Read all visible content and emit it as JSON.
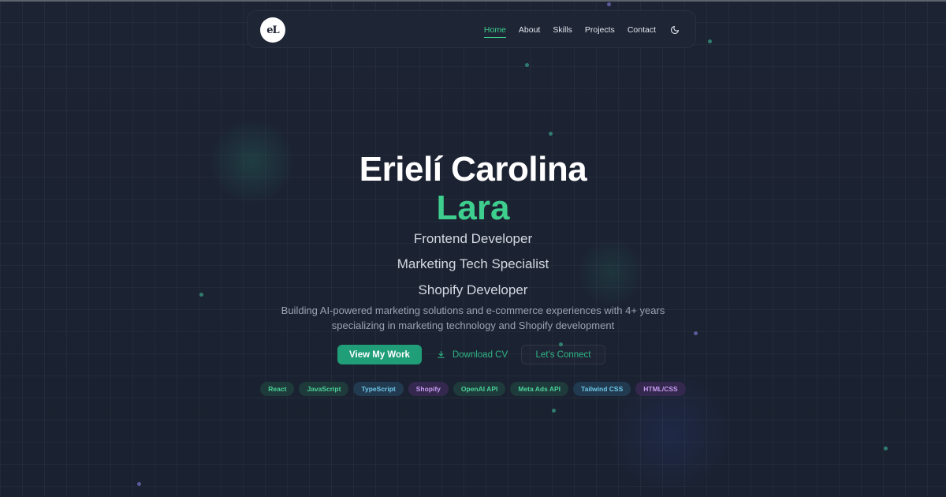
{
  "nav": {
    "logo_text": "eL",
    "links": [
      {
        "label": "Home",
        "active": true
      },
      {
        "label": "About",
        "active": false
      },
      {
        "label": "Skills",
        "active": false
      },
      {
        "label": "Projects",
        "active": false
      },
      {
        "label": "Contact",
        "active": false
      }
    ],
    "theme_toggle_icon": "moon-icon"
  },
  "hero": {
    "name_line1": "Erielí Carolina",
    "name_line2": "Lara",
    "roles": [
      "Frontend Developer",
      "Marketing Tech Specialist",
      "Shopify Developer"
    ],
    "description_line1": "Building AI-powered marketing solutions and e-commerce experiences with 4+ years",
    "description_line2": "specializing in marketing technology and Shopify development"
  },
  "buttons": {
    "primary_label": "View My Work",
    "download_label": "Download CV",
    "download_icon": "download-icon",
    "connect_label": "Let's Connect"
  },
  "tags": [
    {
      "label": "React",
      "color": "green"
    },
    {
      "label": "JavaScript",
      "color": "green"
    },
    {
      "label": "TypeScript",
      "color": "blue"
    },
    {
      "label": "Shopify",
      "color": "purple"
    },
    {
      "label": "OpenAI API",
      "color": "green"
    },
    {
      "label": "Meta Ads API",
      "color": "green"
    },
    {
      "label": "Tailwind CSS",
      "color": "blue"
    },
    {
      "label": "HTML/CSS",
      "color": "purple"
    }
  ],
  "colors": {
    "background": "#1b2231",
    "accent": "#3ecf8e",
    "button_primary": "#1f9e78"
  }
}
